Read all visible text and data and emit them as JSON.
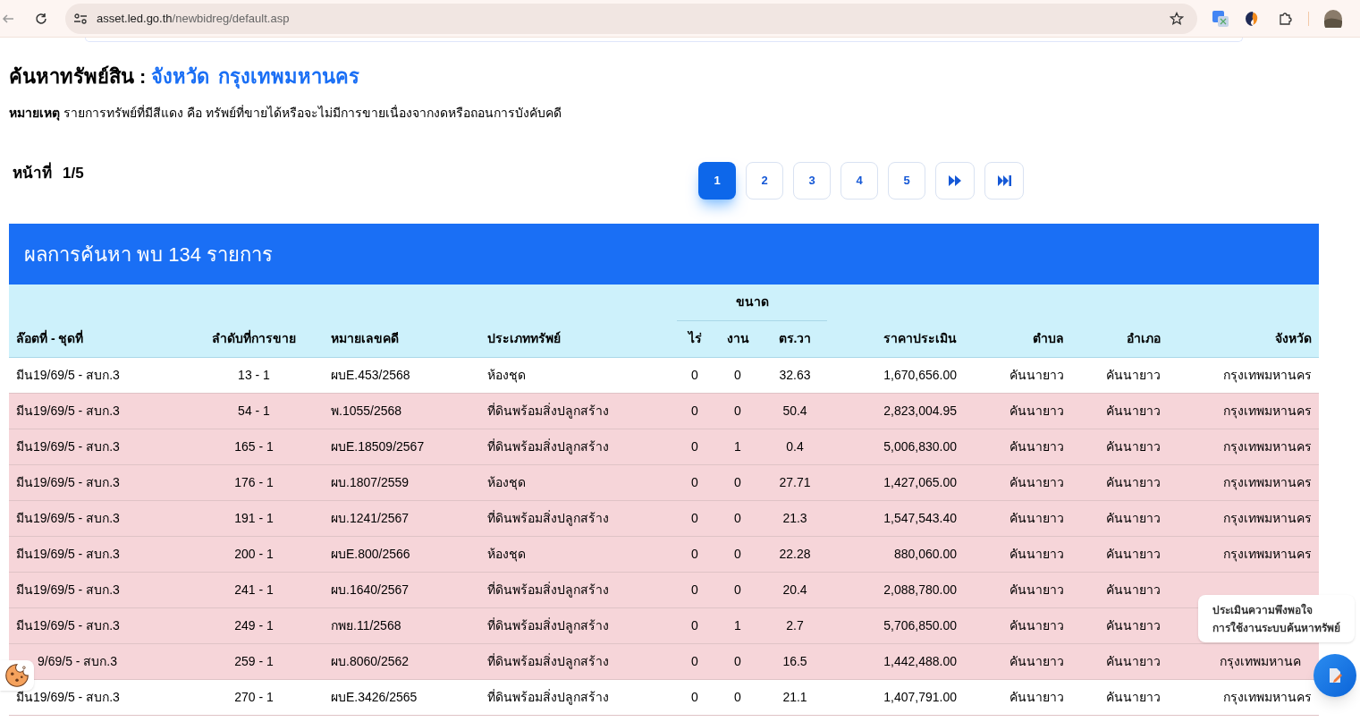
{
  "browser": {
    "url_host": "asset.led.go.th",
    "url_path": "/newbidreg/default.asp"
  },
  "heading": {
    "label": "ค้นหาทรัพย์สิน :",
    "province_label": "จังหวัด",
    "province": "กรุงเทพมหานคร"
  },
  "note": "**หมายเหตุ** รายการทรัพย์ที่มีสีแดง คือ ทรัพย์ที่ขายได้หรือจะไม่มีการขายเนื่องจากงดหรือถอนการบังคับคดี",
  "page_indicator": {
    "label": "หน้าที่",
    "value": "1/5"
  },
  "pagination": [
    {
      "kind": "page",
      "label": "1",
      "selected": true
    },
    {
      "kind": "page",
      "label": "2",
      "selected": false
    },
    {
      "kind": "page",
      "label": "3",
      "selected": false
    },
    {
      "kind": "page",
      "label": "4",
      "selected": false
    },
    {
      "kind": "page",
      "label": "5",
      "selected": false
    },
    {
      "kind": "next",
      "selected": false
    },
    {
      "kind": "last",
      "selected": false
    }
  ],
  "results": {
    "title": "ผลการค้นหา พบ 134 รายการ",
    "group_header": "ขนาด",
    "columns": [
      "ล๊อตที่ - ชุดที่",
      "ลำดับที่การขาย",
      "หมายเลขคดี",
      "ประเภททรัพย์",
      "ไร่",
      "งาน",
      "ตร.วา",
      "ราคาประเมิน",
      "ตำบล",
      "อำเภอ",
      "จังหวัด"
    ],
    "rows": [
      {
        "highlighted": false,
        "covered": false,
        "cells": [
          "มีน19/69/5 - สบก.3",
          "13 - 1",
          "ผบE.453/2568",
          "ห้องชุด",
          "0",
          "0",
          "32.63",
          "1,670,656.00",
          "คันนายาว",
          "คันนายาว",
          "กรุงเทพมหานคร"
        ]
      },
      {
        "highlighted": true,
        "covered": false,
        "cells": [
          "มีน19/69/5 - สบก.3",
          "54 - 1",
          "พ.1055/2568",
          "ที่ดินพร้อมสิ่งปลูกสร้าง",
          "0",
          "0",
          "50.4",
          "2,823,004.95",
          "คันนายาว",
          "คันนายาว",
          "กรุงเทพมหานคร"
        ]
      },
      {
        "highlighted": true,
        "covered": false,
        "cells": [
          "มีน19/69/5 - สบก.3",
          "165 - 1",
          "ผบE.18509/2567",
          "ที่ดินพร้อมสิ่งปลูกสร้าง",
          "0",
          "1",
          "0.4",
          "5,006,830.00",
          "คันนายาว",
          "คันนายาว",
          "กรุงเทพมหานคร"
        ]
      },
      {
        "highlighted": true,
        "covered": false,
        "cells": [
          "มีน19/69/5 - สบก.3",
          "176 - 1",
          "ผบ.1807/2559",
          "ห้องชุด",
          "0",
          "0",
          "27.71",
          "1,427,065.00",
          "คันนายาว",
          "คันนายาว",
          "กรุงเทพมหานคร"
        ]
      },
      {
        "highlighted": true,
        "covered": false,
        "cells": [
          "มีน19/69/5 - สบก.3",
          "191 - 1",
          "ผบ.1241/2567",
          "ที่ดินพร้อมสิ่งปลูกสร้าง",
          "0",
          "0",
          "21.3",
          "1,547,543.40",
          "คันนายาว",
          "คันนายาว",
          "กรุงเทพมหานคร"
        ]
      },
      {
        "highlighted": true,
        "covered": false,
        "cells": [
          "มีน19/69/5 - สบก.3",
          "200 - 1",
          "ผบE.800/2566",
          "ห้องชุด",
          "0",
          "0",
          "22.28",
          "880,060.00",
          "คันนายาว",
          "คันนายาว",
          "กรุงเทพมหานคร"
        ]
      },
      {
        "highlighted": true,
        "covered": false,
        "cells": [
          "มีน19/69/5 - สบก.3",
          "241 - 1",
          "ผบ.1640/2567",
          "ที่ดินพร้อมสิ่งปลูกสร้าง",
          "0",
          "0",
          "20.4",
          "2,088,780.00",
          "คันนายาว",
          "คันนายาว"
        ]
      },
      {
        "highlighted": true,
        "covered": false,
        "cells": [
          "มีน19/69/5 - สบก.3",
          "249 - 1",
          "กพย.11/2568",
          "ที่ดินพร้อมสิ่งปลูกสร้าง",
          "0",
          "1",
          "2.7",
          "5,706,850.00",
          "คันนายาว",
          "คันนายาว"
        ]
      },
      {
        "highlighted": true,
        "covered": true,
        "cells": [
          "9/69/5 - สบก.3",
          "259 - 1",
          "ผบ.8060/2562",
          "ที่ดินพร้อมสิ่งปลูกสร้าง",
          "0",
          "0",
          "16.5",
          "1,442,488.00",
          "คันนายาว",
          "คันนายาว",
          "กรุงเทพมหานค"
        ]
      },
      {
        "highlighted": false,
        "covered": false,
        "cells": [
          "มีน19/69/5 - สบก.3",
          "270 - 1",
          "ผบE.3426/2565",
          "ที่ดินพร้อมสิ่งปลูกสร้าง",
          "0",
          "0",
          "21.1",
          "1,407,791.00",
          "คันนายาว",
          "คันนายาว",
          "กรุงเทพมหานคร"
        ]
      }
    ]
  },
  "feedback_tooltip": [
    "ประเมินความพึงพอใจ",
    "การใช้งานระบบค้นหาทรัพย์"
  ]
}
